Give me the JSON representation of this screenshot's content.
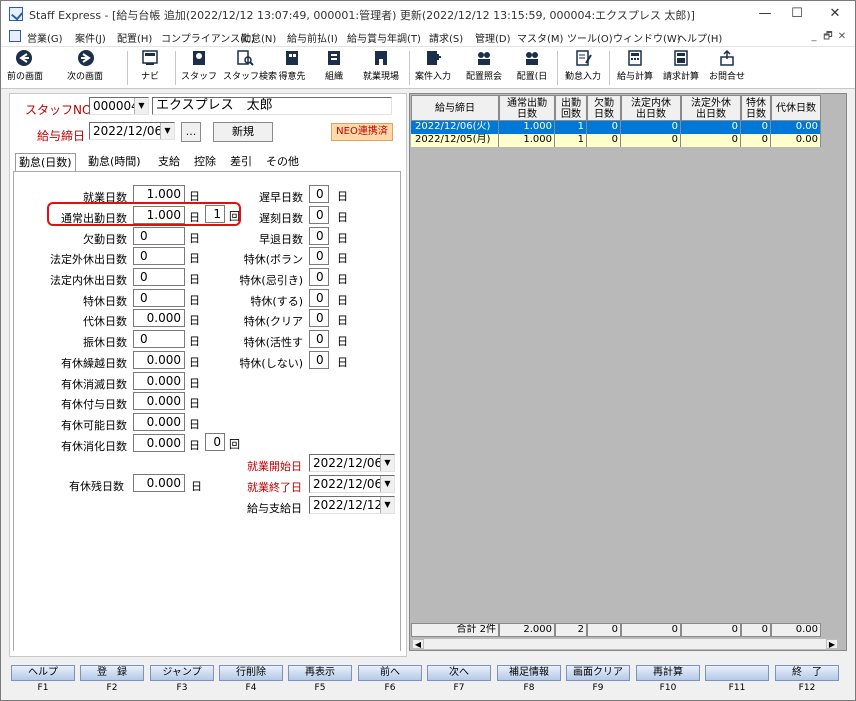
{
  "window": {
    "title": "Staff Express - [給与台帳 追加(2022/12/12 13:07:49, 000001:管理者) 更新(2022/12/12 13:15:59, 000004:エクスプレス 太郎)]",
    "min": "—",
    "max": "☐",
    "close": "✕"
  },
  "menu": {
    "items": [
      "営業(G)",
      "案件(J)",
      "配置(H)",
      "コンプライアンス(C)",
      "勤怠(N)",
      "給与前払(I)",
      "給与賞与年調(T)",
      "請求(S)",
      "管理(D)",
      "マスタ(M)",
      "ツール(O)",
      "ウィンドウ(W)",
      "ヘルプ(H)"
    ],
    "mdi_min": "_",
    "mdi_restore": "🗗",
    "mdi_close": "✕"
  },
  "toolbar": {
    "items": [
      "前の画面",
      "次の画面",
      "ナビ",
      "スタッフ",
      "スタッフ検索",
      "得意先",
      "組織",
      "就業現場",
      "案件入力",
      "配置照会",
      "配置(日",
      "勤怠入力",
      "給与計算",
      "請求計算",
      "お問合せ"
    ]
  },
  "header": {
    "staff_label": "スタッフNO",
    "staff_no": "000004",
    "staff_name": "エクスプレス　太郎",
    "payday_label": "給与締日",
    "payday": "2022/12/06",
    "ellipsis": "...",
    "new_button": "新規",
    "neo_badge": "NEO連携済"
  },
  "tabs": [
    "勤怠(日数)",
    "勤怠(時間)",
    "支給",
    "控除",
    "差引",
    "その他"
  ],
  "left_fields": [
    {
      "label": "就業日数",
      "value": "1.000",
      "unit": "日"
    },
    {
      "label": "通常出勤日数",
      "value": "1.000",
      "unit": "日"
    },
    {
      "label": "欠勤日数",
      "value": "0",
      "unit": "日"
    },
    {
      "label": "法定外休出日数",
      "value": "0",
      "unit": "日"
    },
    {
      "label": "法定内休出日数",
      "value": "0",
      "unit": "日"
    },
    {
      "label": "特休日数",
      "value": "0",
      "unit": "日"
    },
    {
      "label": "代休日数",
      "value": "0.000",
      "unit": "日"
    },
    {
      "label": "振休日数",
      "value": "0",
      "unit": "日"
    },
    {
      "label": "有休繰越日数",
      "value": "0.000",
      "unit": "日"
    },
    {
      "label": "有休消滅日数",
      "value": "0.000",
      "unit": "日"
    },
    {
      "label": "有休付与日数",
      "value": "0.000",
      "unit": "日"
    },
    {
      "label": "有休可能日数",
      "value": "0.000",
      "unit": "日"
    },
    {
      "label": "有休消化日数",
      "value": "0.000",
      "unit": "日"
    }
  ],
  "times": {
    "tsujo_count": "1",
    "yukyu_count": "0",
    "unit": "回"
  },
  "right_fields": [
    {
      "label": "遅早日数",
      "value": "0",
      "unit": "日"
    },
    {
      "label": "遅刻日数",
      "value": "0",
      "unit": "日"
    },
    {
      "label": "早退日数",
      "value": "0",
      "unit": "日"
    },
    {
      "label": "特休(ボラン",
      "value": "0",
      "unit": "日"
    },
    {
      "label": "特休(忌引き)",
      "value": "0",
      "unit": "日"
    },
    {
      "label": "特休(する)",
      "value": "0",
      "unit": "日"
    },
    {
      "label": "特休(クリア",
      "value": "0",
      "unit": "日"
    },
    {
      "label": "特休(活性す",
      "value": "0",
      "unit": "日"
    },
    {
      "label": "特休(しない)",
      "value": "0",
      "unit": "日"
    }
  ],
  "dates": {
    "start_label": "就業開始日",
    "start": "2022/12/06",
    "end_label": "就業終了日",
    "end": "2022/12/06",
    "pay_label": "給与支給日",
    "pay": "2022/12/12"
  },
  "remain": {
    "label": "有休残日数",
    "value": "0.000",
    "unit": "日"
  },
  "grid": {
    "headers": [
      "給与締日",
      "通常出勤\n日数",
      "出勤\n回数",
      "欠勤\n日数",
      "法定内休\n出日数",
      "法定外休\n出日数",
      "特休\n日数",
      "代休日数"
    ],
    "rows": [
      [
        "2022/12/06(火)",
        "1.000",
        "1",
        "0",
        "0",
        "0",
        "0",
        "0.00"
      ],
      [
        "2022/12/05(月)",
        "1.000",
        "1",
        "0",
        "0",
        "0",
        "0",
        "0.00"
      ]
    ],
    "footer": [
      "合計 2件",
      "2.000",
      "2",
      "0",
      "0",
      "0",
      "0",
      "0.00"
    ]
  },
  "fkeys": [
    {
      "label": "ヘルプ",
      "key": "F1"
    },
    {
      "label": "登　録",
      "key": "F2"
    },
    {
      "label": "ジャンプ",
      "key": "F3"
    },
    {
      "label": "行削除",
      "key": "F4"
    },
    {
      "label": "再表示",
      "key": "F5"
    },
    {
      "label": "前へ",
      "key": "F6"
    },
    {
      "label": "次へ",
      "key": "F7"
    },
    {
      "label": "補足情報",
      "key": "F8"
    },
    {
      "label": "画面クリア",
      "key": "F9"
    },
    {
      "label": "再計算",
      "key": "F10"
    },
    {
      "label": "",
      "key": "F11"
    },
    {
      "label": "終　了",
      "key": "F12"
    }
  ],
  "colors": {
    "accent": "#0066cc",
    "selected_row": "#0078d7",
    "highlight": "#e01010",
    "neo_badge": "#ffd9a8",
    "row2_bg": "#ffffcc"
  }
}
